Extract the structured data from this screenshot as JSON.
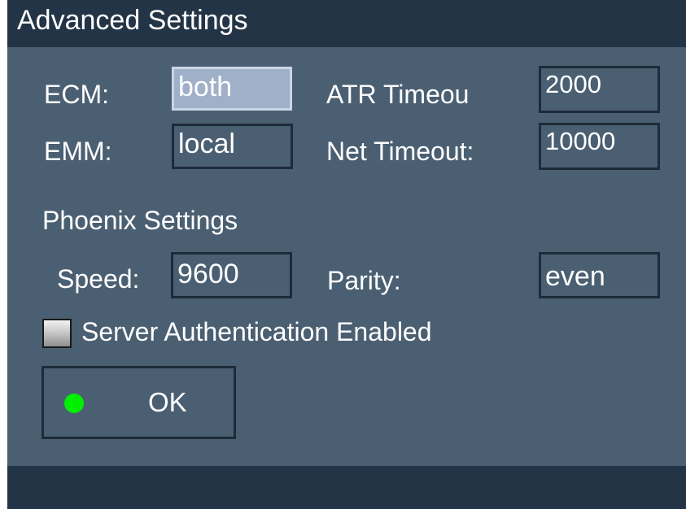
{
  "window": {
    "title": "Advanced Settings"
  },
  "fields": {
    "ecm": {
      "label": "ECM:",
      "value": "both"
    },
    "emm": {
      "label": "EMM:",
      "value": "local"
    },
    "atr_timeout": {
      "label": "ATR Timeou",
      "value": "2000"
    },
    "net_timeout": {
      "label": "Net Timeout:",
      "value": "10000"
    }
  },
  "phoenix": {
    "heading": "Phoenix Settings",
    "speed": {
      "label": "Speed:",
      "value": "9600"
    },
    "parity": {
      "label": "Parity:",
      "value": "even"
    }
  },
  "auth_checkbox": {
    "label": "Server Authentication Enabled",
    "checked": false
  },
  "ok_button": {
    "label": "OK",
    "indicator_color": "#00ee00"
  }
}
